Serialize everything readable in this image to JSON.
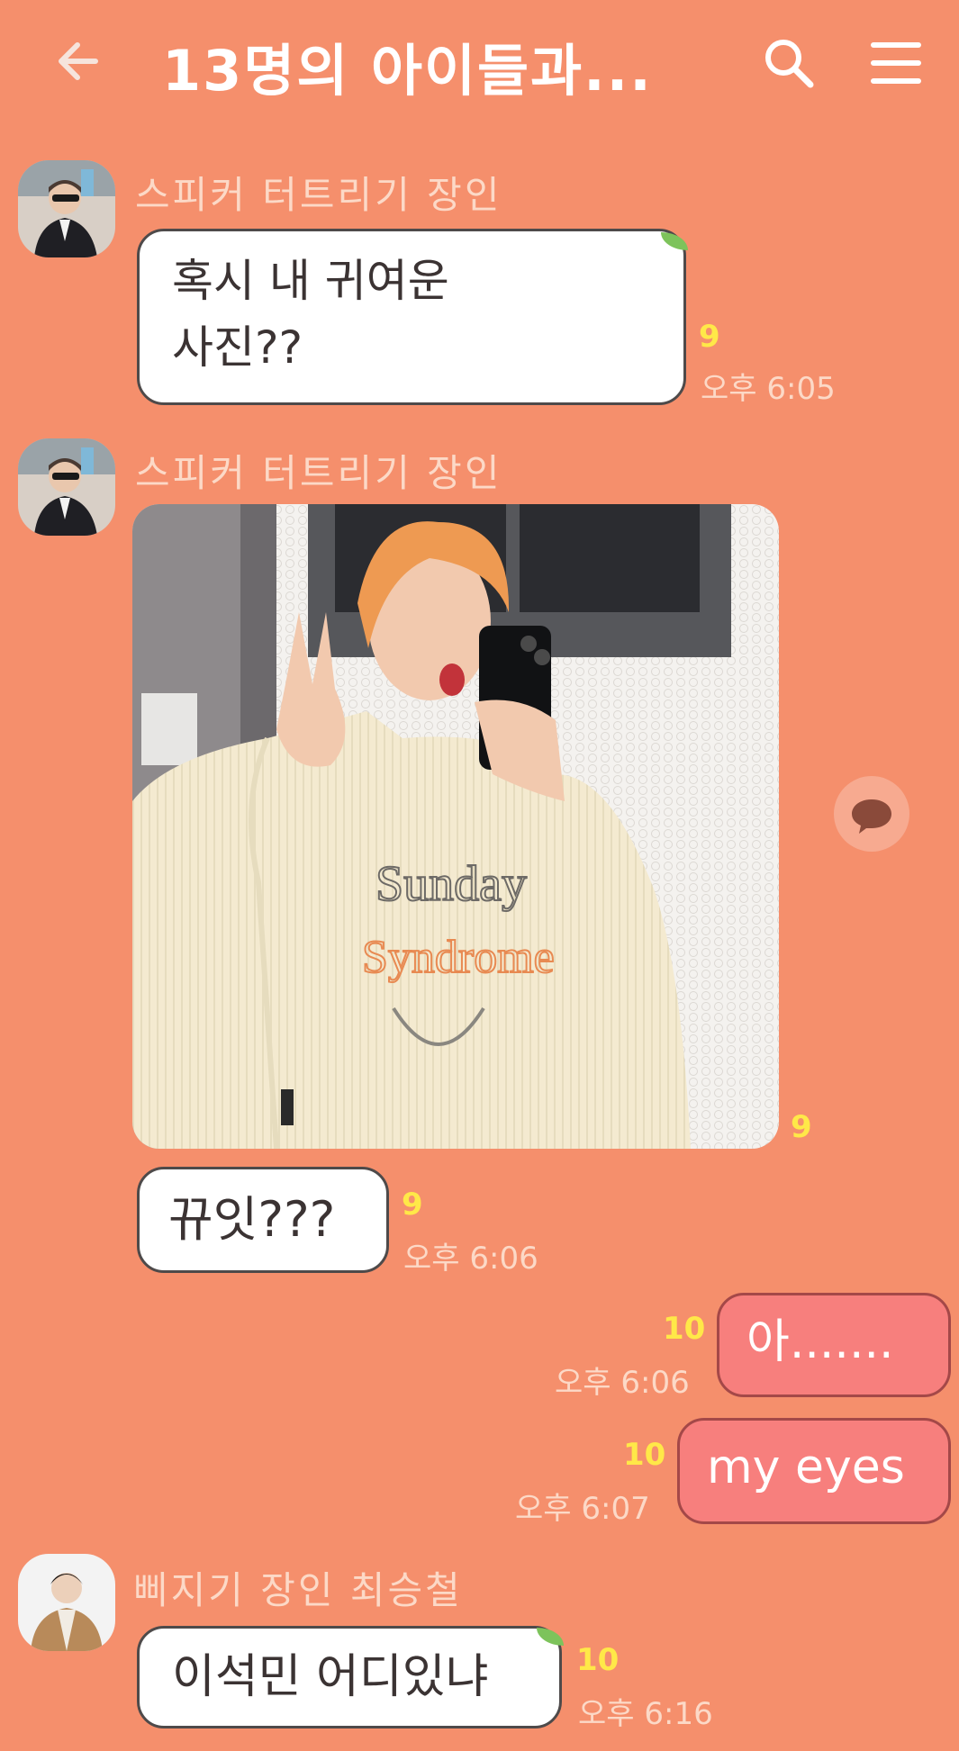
{
  "header": {
    "title": "13명의 아이들과...",
    "back_icon": "back-arrow-icon",
    "search_icon": "search-icon",
    "menu_icon": "menu-icon"
  },
  "messages": [
    {
      "sender": "스피커 터트리기 장인",
      "lines": [
        "혹시 내 귀여운",
        "사진??"
      ],
      "unread": "9",
      "time": "오후 6:05"
    },
    {
      "sender": "스피커 터트리기 장인",
      "photo_unread": "9",
      "text": "뀨잇???",
      "unread": "9",
      "time": "오후 6:06"
    },
    {
      "text": "아.......",
      "unread": "10",
      "time": "오후 6:06"
    },
    {
      "text": "my eyes",
      "unread": "10",
      "time": "오후 6:07"
    },
    {
      "sender": "삐지기 장인 최승철",
      "text": "이석민 어디있냐",
      "unread": "10",
      "time": "오후 6:16"
    }
  ],
  "colors": {
    "background": "#f58f6c",
    "outgoing_bubble": "#f77f7d",
    "unread": "#ffe848",
    "meta_text": "#fcd9c7"
  },
  "floating_button_icon": "chat-bubble-icon"
}
